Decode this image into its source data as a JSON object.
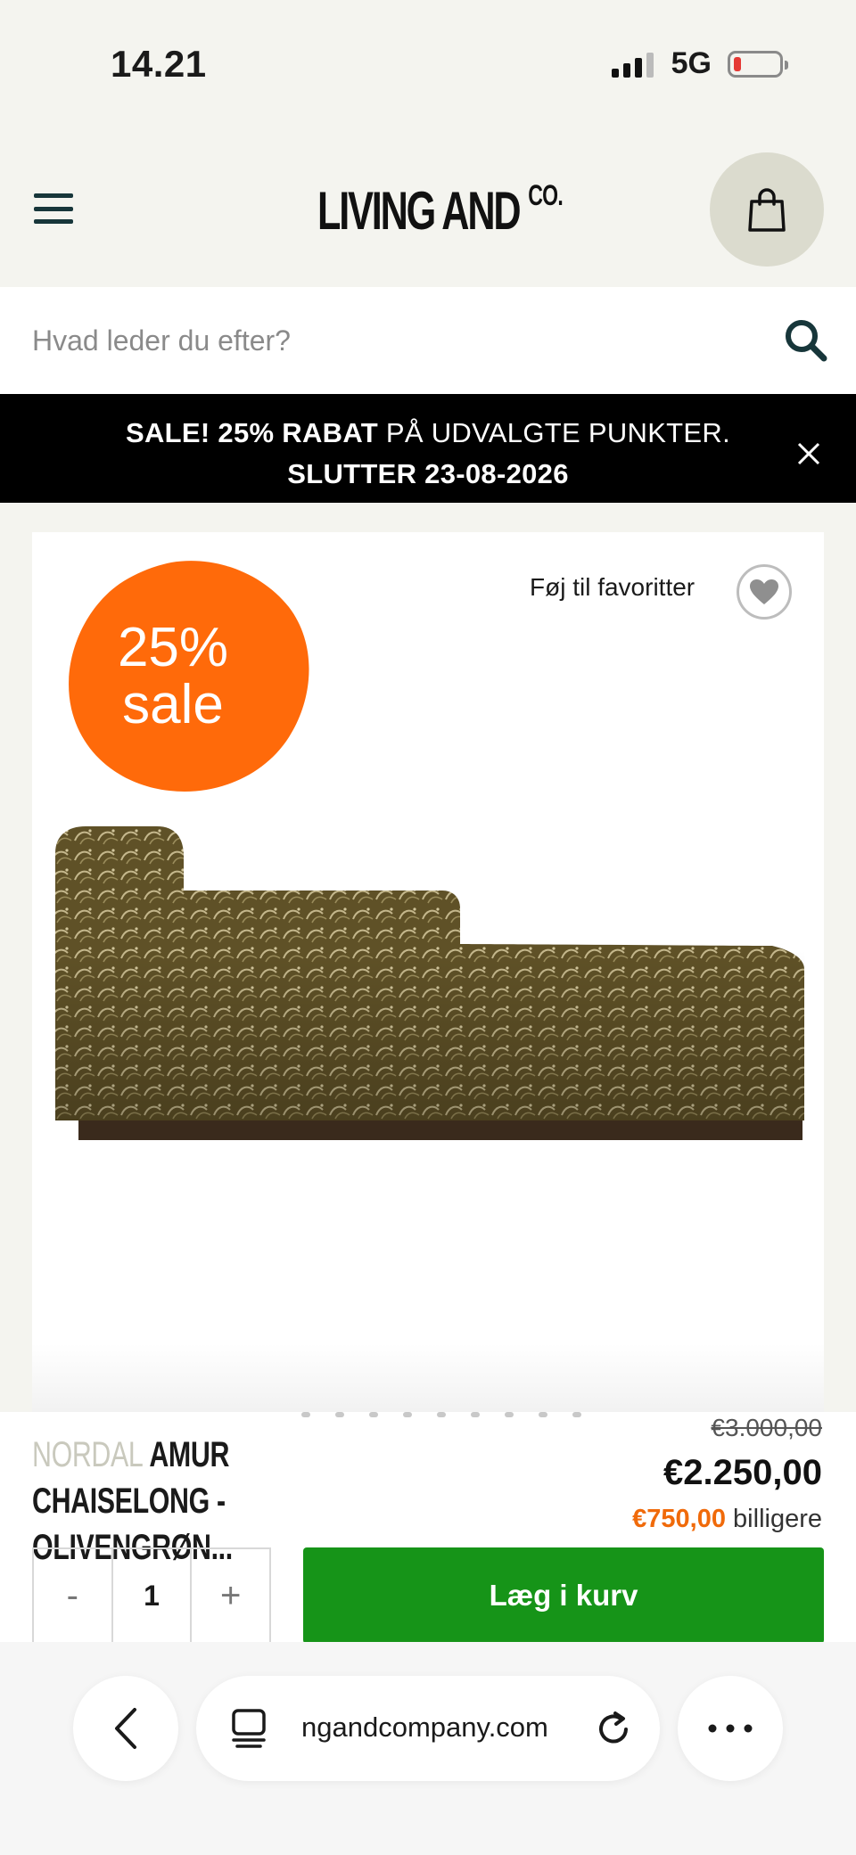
{
  "status": {
    "time": "14.21",
    "network": "5G",
    "battery_level": 0.1
  },
  "header": {
    "logo_main": "LIVING AND",
    "logo_sup": "CO."
  },
  "search": {
    "placeholder": "Hvad leder du efter?"
  },
  "promo": {
    "bold": "SALE! 25% RABAT",
    "rest": " PÅ UDVALGTE PUNKTER.",
    "line2": "SLUTTER 23-08-2026"
  },
  "product": {
    "sale_badge_line1": "25%",
    "sale_badge_line2": "sale",
    "favorite_label": "Føj til favoritter",
    "brand": "NORDAL",
    "title": " AMUR CHAISELONG - OLIVENGRØN...",
    "old_price": "€3.000,00",
    "new_price": "€2.250,00",
    "savings_amount": "€750,00",
    "savings_label": " billigere",
    "image_dots": 9,
    "quantity": "1",
    "qty_minus": "-",
    "qty_plus": "+",
    "add_to_cart": "Læg i kurv"
  },
  "browser": {
    "url": "ngandcompany.com"
  },
  "colors": {
    "background": "#f4f4ef",
    "header_icon": "#17363a",
    "cart_circle": "#dbdbce",
    "promo_bg": "#000000",
    "sale_badge": "#ff6a0a",
    "cta": "#169418",
    "savings": "#f06a0a"
  },
  "icons": [
    "hamburger-menu-icon",
    "shopping-bag-icon",
    "search-icon",
    "close-icon",
    "heart-icon",
    "chevron-left-icon",
    "tabs-icon",
    "reload-icon",
    "more-icon"
  ]
}
